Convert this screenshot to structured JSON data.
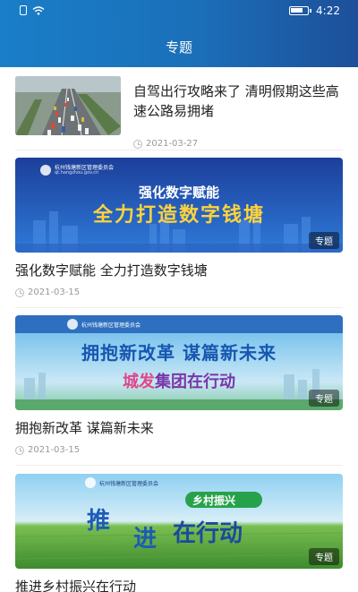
{
  "status_bar": {
    "time": "4:22"
  },
  "header": {
    "title": "专题"
  },
  "items": [
    {
      "headline": "自驾出行攻略来了 清明假期这些高速公路易拥堵",
      "date": "2021-03-27"
    },
    {
      "headline": "强化数字赋能 全力打造数字钱塘",
      "date": "2021-03-15",
      "tag": "专题",
      "banner": {
        "line1": "强化数字赋能",
        "line2": "全力打造数字钱塘",
        "org": "杭州钱塘新区管理委员会",
        "org_sub": "qt.hangzhou.gov.cn"
      }
    },
    {
      "headline": "拥抱新改革 谋篇新未来",
      "date": "2021-03-15",
      "tag": "专题",
      "banner": {
        "line1": "拥抱新改革 谋篇新未来",
        "line2_a": "城发",
        "line2_b": "集团在行动",
        "org": "杭州钱塘新区管理委员会"
      }
    },
    {
      "headline": "推进乡村振兴在行动",
      "tag": "专题",
      "banner": {
        "badge": "乡村振兴",
        "line_a": "推",
        "line_b": "进",
        "line_c": "在行动",
        "org": "杭州钱塘新区管理委员会"
      }
    }
  ],
  "colors": {
    "header_start": "#1a7ec8",
    "header_end": "#1d4f99",
    "meta_text": "#999999"
  }
}
